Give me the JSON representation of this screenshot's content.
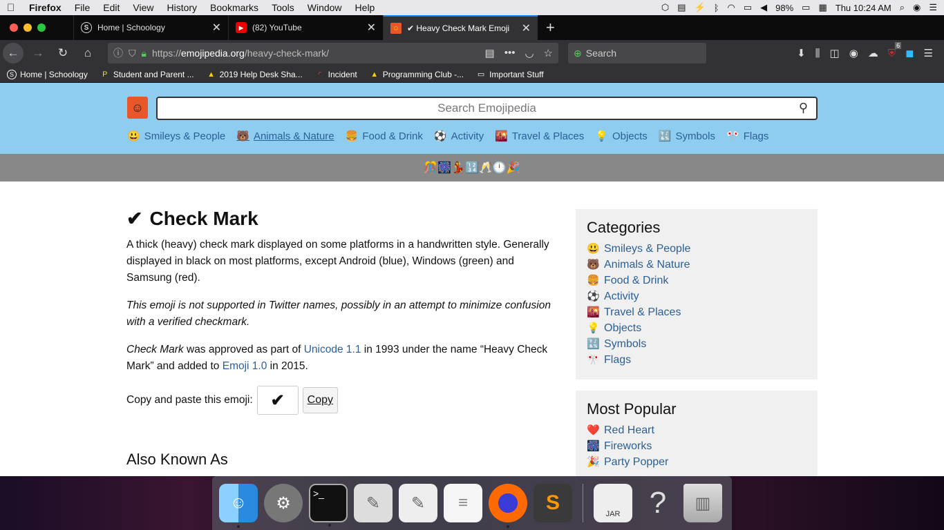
{
  "menubar": {
    "app": "Firefox",
    "items": [
      "File",
      "Edit",
      "View",
      "History",
      "Bookmarks",
      "Tools",
      "Window",
      "Help"
    ],
    "battery": "98%",
    "clock": "Thu 10:24 AM"
  },
  "tabs": [
    {
      "label": "Home | Schoology",
      "icon": "schoology-icon"
    },
    {
      "label": "(82) YouTube",
      "icon": "youtube-icon"
    },
    {
      "label": "✔ Heavy Check Mark Emoji",
      "icon": "emojipedia-icon",
      "active": true
    }
  ],
  "navbar": {
    "url_prefix": "https://",
    "url_host": "emojipedia.org",
    "url_path": "/heavy-check-mark/",
    "search_placeholder": "Search",
    "badge": "6"
  },
  "bookmarks": [
    {
      "label": "Home | Schoology",
      "icon": "schoology-icon"
    },
    {
      "label": "Student and Parent ...",
      "icon": "bookmark-icon"
    },
    {
      "label": "2019 Help Desk Sha...",
      "icon": "drive-icon"
    },
    {
      "label": "Incident",
      "icon": "incident-icon"
    },
    {
      "label": "Programming Club -...",
      "icon": "drive-icon"
    },
    {
      "label": "Important Stuff",
      "icon": "folder-icon"
    }
  ],
  "site": {
    "search_placeholder": "Search Emojipedia",
    "nav": [
      {
        "emoji": "😃",
        "label": "Smileys & People"
      },
      {
        "emoji": "🐻",
        "label": "Animals & Nature"
      },
      {
        "emoji": "🍔",
        "label": "Food & Drink"
      },
      {
        "emoji": "⚽",
        "label": "Activity"
      },
      {
        "emoji": "🌇",
        "label": "Travel & Places"
      },
      {
        "emoji": "💡",
        "label": "Objects"
      },
      {
        "emoji": "🔣",
        "label": "Symbols"
      },
      {
        "emoji": "🎌",
        "label": "Flags"
      }
    ],
    "band_emojis": "🎊🎆💃🔢🥂🕛🎉"
  },
  "article": {
    "glyph": "✔",
    "title": "Check Mark",
    "desc": "A thick (heavy) check mark displayed on some platforms in a handwritten style. Generally displayed in black on most platforms, except Android (blue), Windows (green) and Samsung (red).",
    "note": "This emoji is not supported in Twitter names, possibly in an attempt to minimize confusion with a verified checkmark.",
    "approved_name": "Check Mark",
    "approved_t1": " was approved as part of ",
    "unicode_link": "Unicode 1.1",
    "approved_t2": " in 1993 under the name “Heavy Check Mark” and added to ",
    "emoji_link": "Emoji 1.0",
    "approved_t3": " in 2015.",
    "copy_label": "Copy and paste this emoji:",
    "copy_value": "✔",
    "copy_button": "Copy",
    "aka_heading": "Also Known As"
  },
  "sidebar": {
    "categories_title": "Categories",
    "categories": [
      {
        "emoji": "😃",
        "label": "Smileys & People"
      },
      {
        "emoji": "🐻",
        "label": "Animals & Nature"
      },
      {
        "emoji": "🍔",
        "label": "Food & Drink"
      },
      {
        "emoji": "⚽",
        "label": "Activity"
      },
      {
        "emoji": "🌇",
        "label": "Travel & Places"
      },
      {
        "emoji": "💡",
        "label": "Objects"
      },
      {
        "emoji": "🔣",
        "label": "Symbols"
      },
      {
        "emoji": "🎌",
        "label": "Flags"
      }
    ],
    "popular_title": "Most Popular",
    "popular": [
      {
        "emoji": "❤️",
        "label": "Red Heart"
      },
      {
        "emoji": "🎆",
        "label": "Fireworks"
      },
      {
        "emoji": "🎉",
        "label": "Party Popper"
      }
    ]
  },
  "dock": [
    "Finder",
    "System Preferences",
    "Terminal",
    "Script Editor",
    "TextEdit",
    "TextEdit",
    "Firefox",
    "Sublime Text",
    "JAR Launcher",
    "Unknown",
    "Trash"
  ]
}
